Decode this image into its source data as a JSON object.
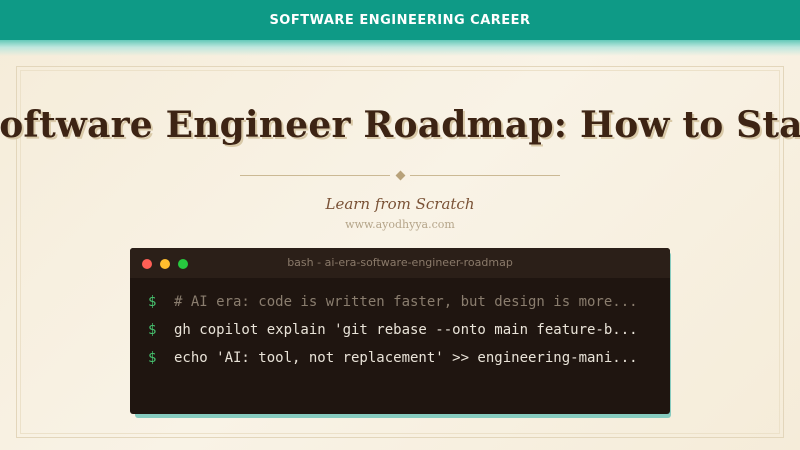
{
  "header": {
    "category": "SOFTWARE ENGINEERING CAREER"
  },
  "article": {
    "title": "Software Engineer Roadmap: How to Stay Relevant",
    "subtitle": "Learn from Scratch",
    "site": "www.ayodhyya.com"
  },
  "terminal": {
    "title": "bash - ai-era-software-engineer-roadmap",
    "prompt": "$",
    "lines": [
      {
        "text": "# AI era: code is written faster, but design is more..."
      },
      {
        "text": "gh copilot explain 'git rebase --onto main feature-b..."
      },
      {
        "text": "echo 'AI: tool, not replacement' >> engineering-mani..."
      }
    ]
  },
  "colors": {
    "accent": "#0e9a86",
    "title": "#3d2414",
    "terminal_bg": "#1f1510",
    "prompt": "#46c06e"
  },
  "icons": [
    "close-dot-icon",
    "minimize-dot-icon",
    "maximize-dot-icon",
    "diamond-ornament-icon"
  ]
}
